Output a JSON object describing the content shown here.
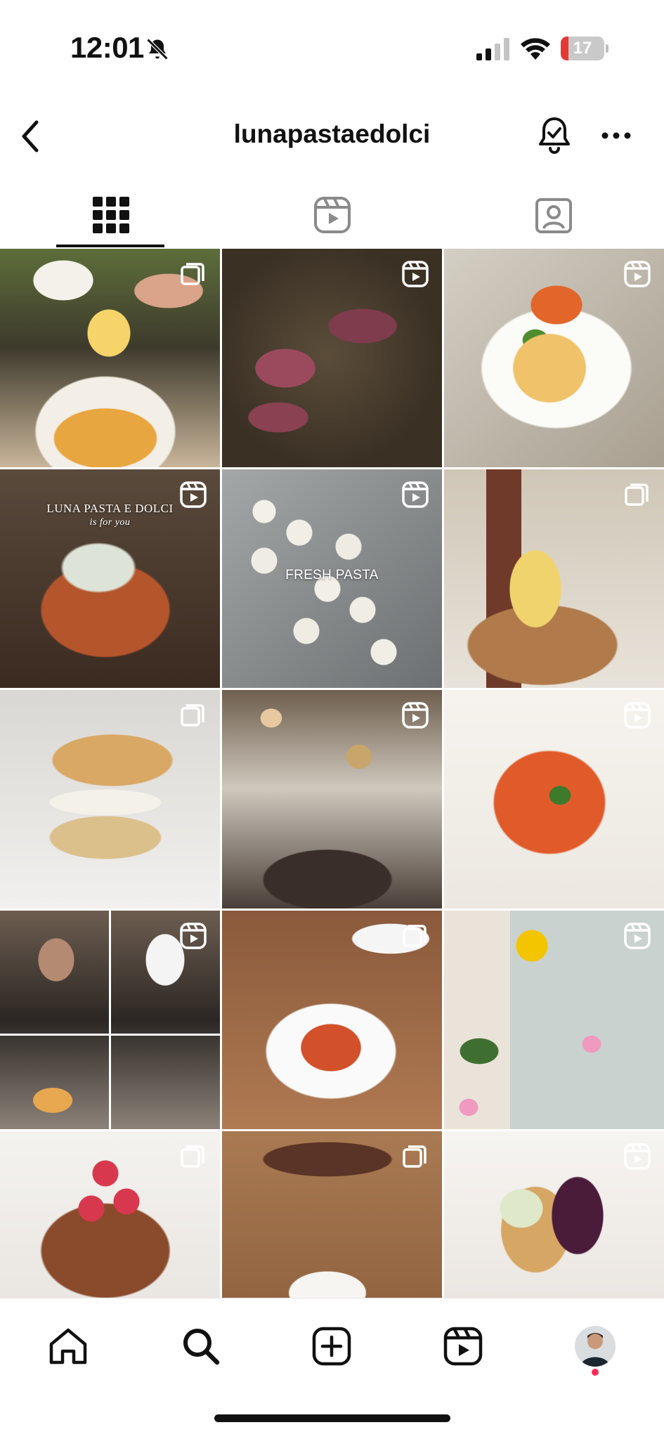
{
  "status_bar": {
    "time": "12:01",
    "battery": "17",
    "battery_level": 0.17,
    "icons": [
      "bell-slash-icon",
      "cellular-signal-icon",
      "wifi-icon",
      "battery-icon"
    ]
  },
  "header": {
    "title": "lunapastaedolci",
    "icons": [
      "chevron-left-icon",
      "bell-check-icon",
      "more-horizontal-icon"
    ]
  },
  "tabs": [
    {
      "icon": "grid-icon",
      "active": true
    },
    {
      "icon": "reels-icon",
      "active": false
    },
    {
      "icon": "tagged-user-icon",
      "active": false
    }
  ],
  "grid": {
    "tiles": [
      {
        "badge": "carousel-icon",
        "caption": ""
      },
      {
        "badge": "reel-icon",
        "caption": ""
      },
      {
        "badge": "reel-icon",
        "caption": ""
      },
      {
        "badge": "reel-icon",
        "caption": "LUNA PASTA E DOLCI",
        "caption_sub": "is for you"
      },
      {
        "badge": "reel-icon",
        "caption": "FRESH PASTA"
      },
      {
        "badge": "carousel-icon",
        "caption": ""
      },
      {
        "badge": "carousel-icon",
        "caption": ""
      },
      {
        "badge": "reel-icon",
        "caption": ""
      },
      {
        "badge": "reel-icon",
        "caption": ""
      },
      {
        "badge": "reel-icon",
        "caption": ""
      },
      {
        "badge": "carousel-icon",
        "caption": ""
      },
      {
        "badge": "reel-icon",
        "caption": ""
      },
      {
        "badge": "carousel-icon",
        "caption": ""
      },
      {
        "badge": "carousel-icon",
        "caption": ""
      },
      {
        "badge": "reel-icon",
        "caption": ""
      }
    ]
  },
  "bottom_nav": {
    "items": [
      "home-icon",
      "search-icon",
      "create-post-icon",
      "reels-icon",
      "profile-avatar"
    ],
    "has_notification": true
  },
  "colors": {
    "text": "#111111",
    "background": "#ffffff",
    "battery_low": "#e53935",
    "notification": "#ff2d55"
  }
}
